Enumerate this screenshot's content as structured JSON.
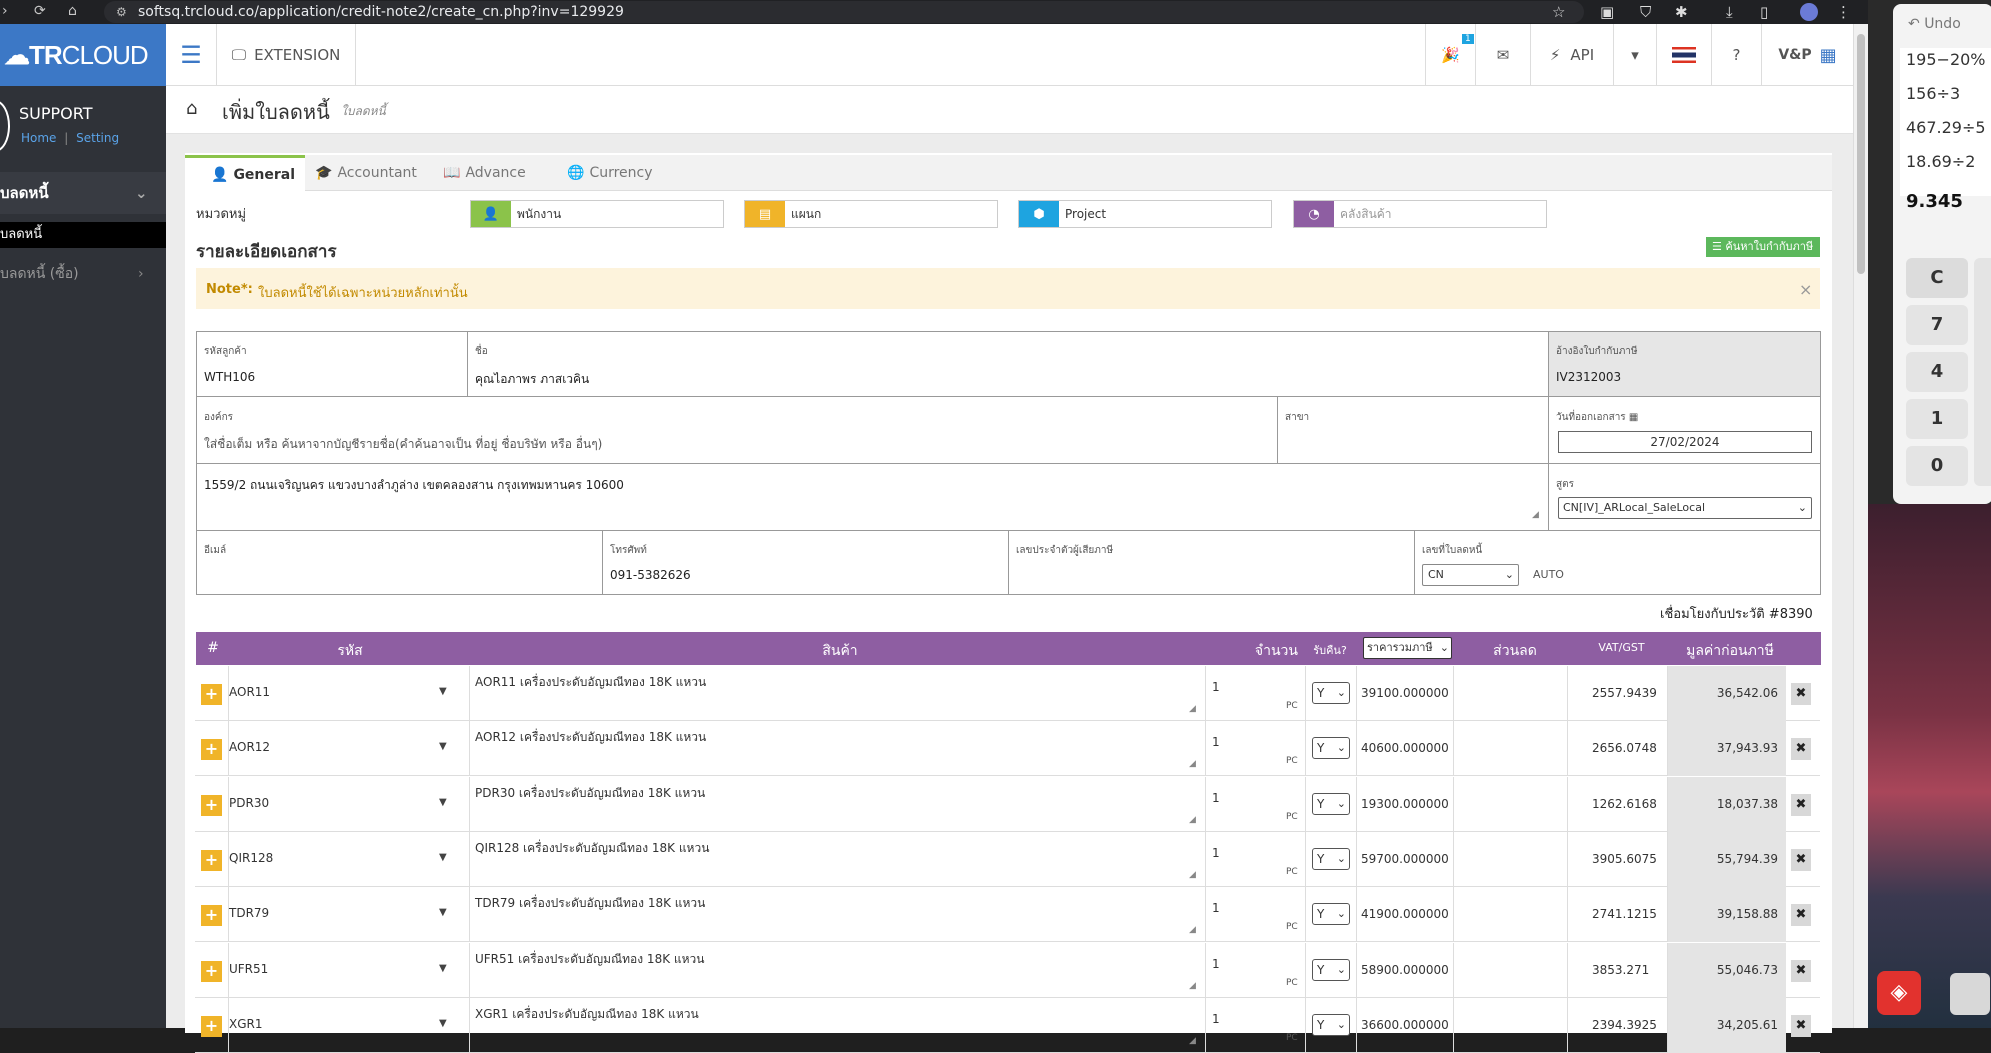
{
  "browser": {
    "url": "softsq.trcloud.co/application/credit-note2/create_cn.php?inv=129929"
  },
  "logo": {
    "tr": "TR",
    "cloud": "CLOUD"
  },
  "profile": {
    "name": "SUPPORT",
    "home": "Home",
    "sep": "|",
    "setting": "Setting"
  },
  "sidebar": {
    "items": [
      {
        "label": "บลดหนี้"
      },
      {
        "label": "บลดหนี้"
      },
      {
        "label": "บลดหนี้ (ซื้อ)"
      }
    ]
  },
  "topbar": {
    "extension": "EXTENSION",
    "badge": "1",
    "api": "API",
    "company": "V&P"
  },
  "page": {
    "title": "เพิ่มใบลดหนี้",
    "subtitle": "ใบลดหนี้"
  },
  "tabs": [
    {
      "label": "General",
      "icon": "user-icon"
    },
    {
      "label": "Accountant",
      "icon": "graduation-cap-icon"
    },
    {
      "label": "Advance",
      "icon": "book-icon"
    },
    {
      "label": "Currency",
      "icon": "globe-icon"
    }
  ],
  "category": {
    "label": "หมวดหมู่",
    "employee": "พนักงาน",
    "department": "แผนก",
    "project": "Project",
    "warehouse_placeholder": "คลังสินค้า"
  },
  "colors": {
    "employee": "#8bc34a",
    "department": "#f0b429",
    "project": "#1ea4e0",
    "warehouse": "#8e5ea2",
    "table_header": "#8e5ea2",
    "search_tax": "#5cb85c"
  },
  "doc": {
    "section_title": "รายละเอียดเอกสาร",
    "search_tax_btn": "ค้นหาใบกำกับภาษี",
    "note_label": "Note*:",
    "note_text": "ใบลดหนี้ใช้ได้เฉพาะหน่วยหลักเท่านั้น",
    "note_close": "×"
  },
  "form": {
    "customer_code_label": "รหัสลูกค้า",
    "customer_code": "WTH106",
    "name_label": "ชื่อ",
    "name": "คุณไอภาพร ภาสเวคิน",
    "tax_ref_label": "อ้างอิงใบกำกับภาษี",
    "tax_ref": "IV2312003",
    "org_label": "องค์กร",
    "org_placeholder": "ใส่ชื่อเต็ม หรือ ค้นหาจากบัญชีรายชื่อ(คำค้นอาจเป็น ที่อยู่ ชื่อบริษัท หรือ อื่นๆ)",
    "branch_label": "สาขา",
    "issue_date_label": "วันที่ออกเอกสาร",
    "issue_date": "27/02/2024",
    "address": "1559/2 ถนนเจริญนคร แขวงบางลำภูล่าง เขตคลองสาน กรุงเทพมหานคร 10600",
    "formula_label": "สูตร",
    "formula": "CN[IV]_ARLocal_SaleLocal",
    "email_label": "อีเมล์",
    "phone_label": "โทรศัพท์",
    "phone": "091-5382626",
    "taxid_label": "เลขประจำตัวผู้เสียภาษี",
    "cn_no_label": "เลขที่ใบลดหนี้",
    "cn_prefix": "CN",
    "cn_auto": "AUTO"
  },
  "history_link": "เชื่อมโยงกับประวัติ #8390",
  "table": {
    "headers": {
      "num": "#",
      "code": "รหัส",
      "product": "สินค้า",
      "qty": "จำนวน",
      "return": "รับคืน?",
      "price_type": "ราคารวมภาษี",
      "discount": "ส่วนลด",
      "vat": "VAT/GST",
      "value": "มูลค่าก่อนภาษี"
    },
    "rows": [
      {
        "code": "AOR11",
        "desc": "AOR11 เครื่องประดับอัญมณีทอง 18K แหวน",
        "qty": "1",
        "unit": "PC",
        "ret": "Y",
        "price": "39100.000000",
        "vat": "2557.9439",
        "value": "36,542.06"
      },
      {
        "code": "AOR12",
        "desc": "AOR12 เครื่องประดับอัญมณีทอง 18K แหวน",
        "qty": "1",
        "unit": "PC",
        "ret": "Y",
        "price": "40600.000000",
        "vat": "2656.0748",
        "value": "37,943.93"
      },
      {
        "code": "PDR30",
        "desc": "PDR30 เครื่องประดับอัญมณีทอง 18K แหวน",
        "qty": "1",
        "unit": "PC",
        "ret": "Y",
        "price": "19300.000000",
        "vat": "1262.6168",
        "value": "18,037.38"
      },
      {
        "code": "QIR128",
        "desc": "QIR128 เครื่องประดับอัญมณีทอง 18K แหวน",
        "qty": "1",
        "unit": "PC",
        "ret": "Y",
        "price": "59700.000000",
        "vat": "3905.6075",
        "value": "55,794.39"
      },
      {
        "code": "TDR79",
        "desc": "TDR79 เครื่องประดับอัญมณีทอง 18K แหวน",
        "qty": "1",
        "unit": "PC",
        "ret": "Y",
        "price": "41900.000000",
        "vat": "2741.1215",
        "value": "39,158.88"
      },
      {
        "code": "UFR51",
        "desc": "UFR51 เครื่องประดับอัญมณีทอง 18K แหวน",
        "qty": "1",
        "unit": "PC",
        "ret": "Y",
        "price": "58900.000000",
        "vat": "3853.271",
        "value": "55,046.73"
      },
      {
        "code": "XGR1",
        "desc": "XGR1 เครื่องประดับอัญมณีทอง 18K แหวน",
        "qty": "1",
        "unit": "PC",
        "ret": "Y",
        "price": "36600.000000",
        "vat": "2394.3925",
        "value": "34,205.61"
      }
    ]
  },
  "calculator": {
    "undo": "Undo",
    "history": [
      "195−20%",
      "156÷3",
      "467.29÷5",
      "18.69÷2"
    ],
    "display": "9.345",
    "keys": [
      "C",
      "7",
      "4",
      "1",
      "0"
    ]
  }
}
